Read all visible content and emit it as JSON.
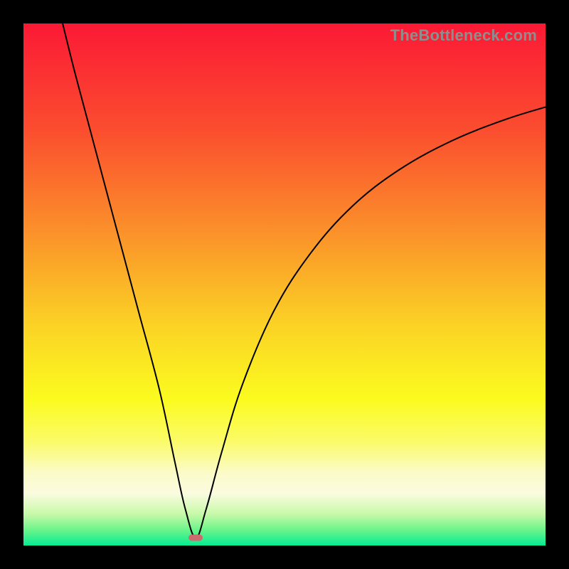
{
  "watermark": "TheBottleneck.com",
  "colors": {
    "page_bg": "#000000",
    "curve": "#000000",
    "nadir_marker": "#cf6b6f",
    "gradient_stops": [
      {
        "pct": 0,
        "color": "#fb1935"
      },
      {
        "pct": 20,
        "color": "#fb4c2f"
      },
      {
        "pct": 40,
        "color": "#fb912a"
      },
      {
        "pct": 58,
        "color": "#fbd325"
      },
      {
        "pct": 72,
        "color": "#fbfb1f"
      },
      {
        "pct": 80,
        "color": "#fbfb68"
      },
      {
        "pct": 86,
        "color": "#fbfbc8"
      },
      {
        "pct": 90,
        "color": "#fbfbe0"
      },
      {
        "pct": 94,
        "color": "#c7f9a8"
      },
      {
        "pct": 97,
        "color": "#6bf48a"
      },
      {
        "pct": 100,
        "color": "#05ec92"
      }
    ]
  },
  "chart_data": {
    "type": "line",
    "title": "",
    "xlabel": "",
    "ylabel": "",
    "xlim": [
      0,
      100
    ],
    "ylim": [
      0,
      100
    ],
    "nadir": {
      "x": 33,
      "y": 1.5
    },
    "series": [
      {
        "name": "bottleneck-curve",
        "points": [
          {
            "x": 7.5,
            "y": 100
          },
          {
            "x": 10,
            "y": 90
          },
          {
            "x": 14,
            "y": 75
          },
          {
            "x": 18,
            "y": 60
          },
          {
            "x": 22,
            "y": 45
          },
          {
            "x": 26,
            "y": 30
          },
          {
            "x": 29,
            "y": 16
          },
          {
            "x": 31,
            "y": 7
          },
          {
            "x": 33,
            "y": 1.5
          },
          {
            "x": 35,
            "y": 7
          },
          {
            "x": 38,
            "y": 18
          },
          {
            "x": 42,
            "y": 31
          },
          {
            "x": 48,
            "y": 45
          },
          {
            "x": 55,
            "y": 56
          },
          {
            "x": 63,
            "y": 65
          },
          {
            "x": 72,
            "y": 72
          },
          {
            "x": 82,
            "y": 77.5
          },
          {
            "x": 92,
            "y": 81.5
          },
          {
            "x": 100,
            "y": 84
          }
        ]
      }
    ]
  }
}
